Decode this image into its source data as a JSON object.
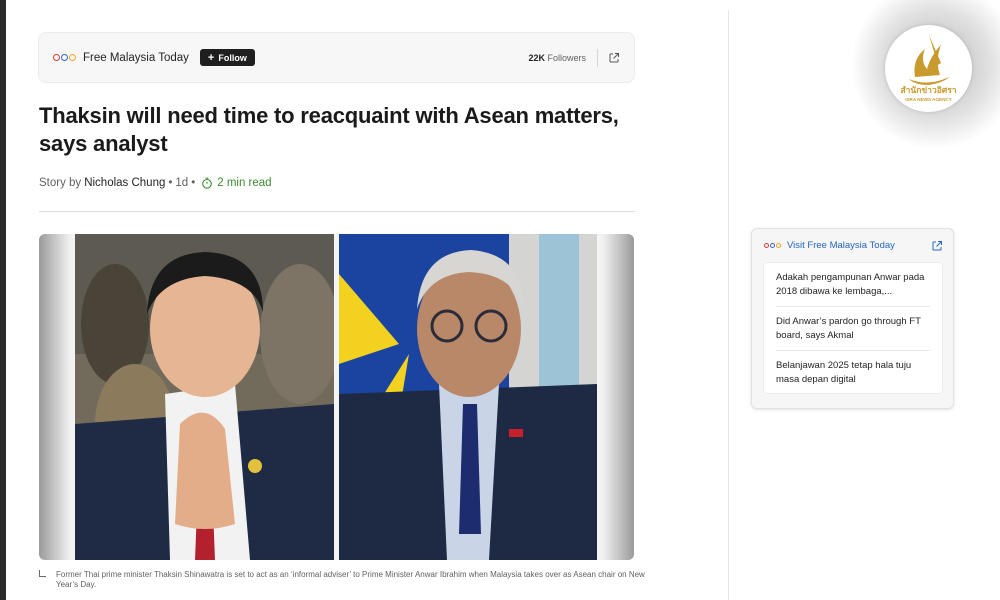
{
  "publisher": {
    "name": "Free Malaysia Today",
    "follow_label": "Follow",
    "followers_count": "22K",
    "followers_label": "Followers",
    "logo_colors": [
      "#e03a2f",
      "#2d6ad6",
      "#f2a623"
    ]
  },
  "article": {
    "headline": "Thaksin will need time to reacquaint with Asean matters, says analyst",
    "story_by_label": "Story by",
    "author": "Nicholas Chung",
    "separator": "•",
    "age": "1d",
    "read_time": "2 min read",
    "caption": "Former Thai prime minister Thaksin Shinawatra is set to act as an ‘informal adviser’ to Prime Minister Anwar Ibrahim when Malaysia takes over as Asean chair on New Year’s Day."
  },
  "sidebar": {
    "visit_label": "Visit Free Malaysia Today",
    "items": [
      {
        "title": "Adakah pengampunan Anwar pada 2018 dibawa ke lembaga,..."
      },
      {
        "title": "Did Anwar’s pardon go through FT board, says Akmal"
      },
      {
        "title": "Belanjawan 2025 tetap hala tuju masa depan digital"
      }
    ]
  },
  "watermark": {
    "thai_name": "สำนักข่าวอิศรา",
    "english_name": "ISRA NEWS AGENCY",
    "color": "#c99a2e"
  },
  "colors": {
    "accent_link": "#2266b8",
    "read_time": "#3a8a2f"
  }
}
